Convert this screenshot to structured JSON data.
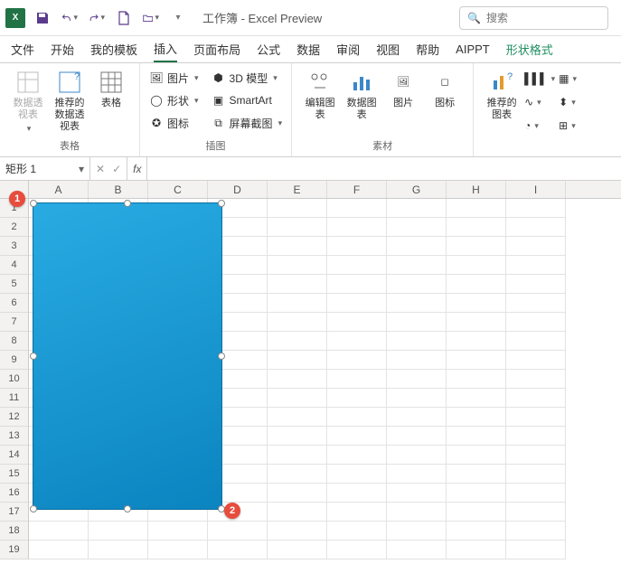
{
  "title": "工作簿 - Excel Preview",
  "search_placeholder": "搜索",
  "tabs": {
    "file": "文件",
    "home": "开始",
    "templates": "我的模板",
    "insert": "插入",
    "layout": "页面布局",
    "formulas": "公式",
    "data": "数据",
    "review": "审阅",
    "view": "视图",
    "help": "帮助",
    "aippt": "AIPPT",
    "shapefmt": "形状格式"
  },
  "ribbon": {
    "tables": {
      "pivot": "数据透视表",
      "recpivot": "推荐的数据透视表",
      "table": "表格",
      "group": "表格"
    },
    "illus": {
      "pictures": "图片",
      "shapes": "形状",
      "icons": "图标",
      "model3d": "3D 模型",
      "smartart": "SmartArt",
      "screenshot": "屏幕截图",
      "group": "插图"
    },
    "charts": {
      "rec": "推荐的图表",
      "edit": "编辑图表",
      "data": "数据图表",
      "pic": "图片",
      "icon": "图标",
      "group": "素材"
    }
  },
  "namebox": "矩形 1",
  "fx": "fx",
  "columns": [
    "A",
    "B",
    "C",
    "D",
    "E",
    "F",
    "G",
    "H",
    "I"
  ],
  "rows": [
    "1",
    "2",
    "3",
    "4",
    "5",
    "6",
    "7",
    "8",
    "9",
    "10",
    "11",
    "12",
    "13",
    "14",
    "15",
    "16",
    "17",
    "18",
    "19"
  ],
  "markers": {
    "m1": "1",
    "m2": "2"
  }
}
